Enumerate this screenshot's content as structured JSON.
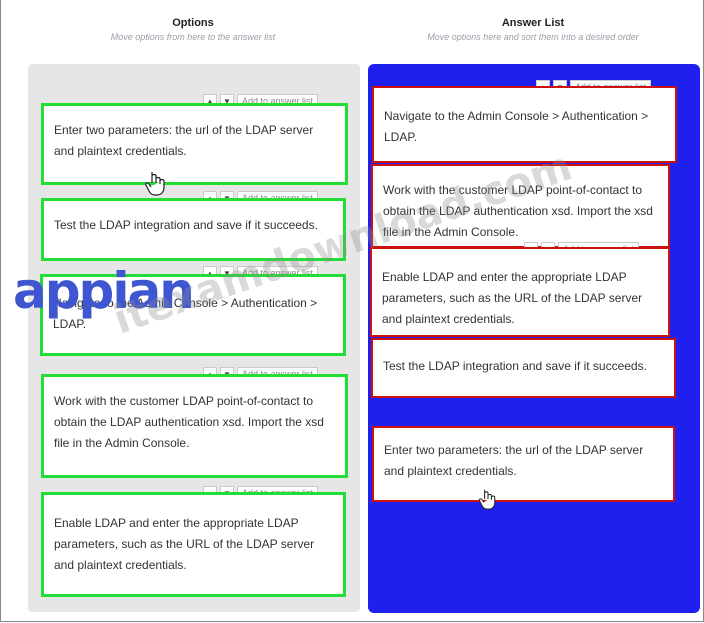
{
  "options": {
    "title": "Options",
    "subtitle": "Move options from here to the answer list",
    "add_label": "Add to answer list",
    "items": [
      {
        "text": "Enter two parameters: the url of the LDAP server and plaintext credentials."
      },
      {
        "text": "Test the LDAP integration and save if it succeeds."
      },
      {
        "text": "Navigate to the Admin Console > Authentication > LDAP."
      },
      {
        "text": "Work with the customer LDAP point-of-contact to obtain the LDAP authentication xsd. Import the xsd file in the Admin Console."
      },
      {
        "text": "Enable LDAP and enter the appropriate LDAP parameters, such as the URL of the LDAP server and plaintext credentials."
      }
    ]
  },
  "answer_list": {
    "title": "Answer List",
    "subtitle": "Move options here and sort them into a desired order",
    "add_label": "Add to answer list",
    "items": [
      {
        "text": "Navigate to the Admin Console > Authentication > LDAP."
      },
      {
        "text": "Work with the customer LDAP point-of-contact to obtain the LDAP authentication xsd. Import the xsd file in the Admin Console."
      },
      {
        "text": "Enable LDAP and enter the appropriate LDAP parameters, such as the URL of the LDAP server and plaintext credentials."
      },
      {
        "text": "Test the LDAP integration and save if it succeeds."
      },
      {
        "text": "Enter two parameters: the url of the LDAP server and plaintext credentials."
      }
    ]
  },
  "logo": {
    "text": "appian"
  },
  "watermark": {
    "text": "itexamdownload.com"
  },
  "icons": {
    "up": "chevron-up-icon",
    "down": "chevron-down-icon",
    "cursor": "hand-cursor-icon"
  },
  "colors": {
    "answer_panel": "#2020ee",
    "options_panel": "#e6e6e6",
    "option_border": "#22dd33",
    "answer_border": "#cc1111",
    "logo": "#3e57d1"
  }
}
